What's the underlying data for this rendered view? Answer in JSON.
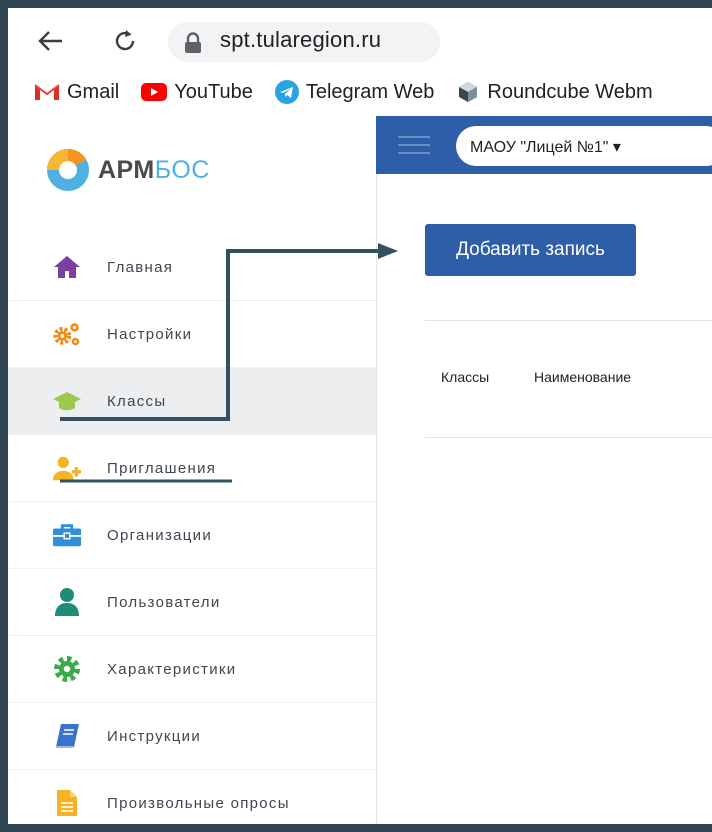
{
  "browser": {
    "url": "spt.tularegion.ru",
    "bookmarks": [
      {
        "label": "Gmail",
        "icon": "gmail-icon"
      },
      {
        "label": "YouTube",
        "icon": "youtube-icon"
      },
      {
        "label": "Telegram Web",
        "icon": "telegram-icon"
      },
      {
        "label": "Roundcube Webm",
        "icon": "roundcube-icon"
      }
    ]
  },
  "logo": {
    "part1": "АРМ",
    "part2": "БОС"
  },
  "sidebar": {
    "items": [
      {
        "label": "Главная",
        "icon": "home-icon",
        "color": "#7b3fa0"
      },
      {
        "label": "Настройки",
        "icon": "gears-icon",
        "color": "#f08c1a"
      },
      {
        "label": "Классы",
        "icon": "graduation-cap-icon",
        "color": "#9cc84b",
        "active": true
      },
      {
        "label": "Приглашения",
        "icon": "user-plus-icon",
        "color": "#f5b324"
      },
      {
        "label": "Организации",
        "icon": "briefcase-icon",
        "color": "#2f8fd8"
      },
      {
        "label": "Пользователи",
        "icon": "user-icon",
        "color": "#1e8c76"
      },
      {
        "label": "Характеристики",
        "icon": "gear-icon",
        "color": "#3aaa4a"
      },
      {
        "label": "Инструкции",
        "icon": "book-icon",
        "color": "#3a74c9"
      },
      {
        "label": "Произвольные опросы",
        "icon": "document-icon",
        "color": "#f5b324"
      }
    ]
  },
  "header": {
    "org_select": "МАОУ \"Лицей №1\""
  },
  "main": {
    "add_button": "Добавить запись",
    "columns": [
      "Классы",
      "Наименование"
    ]
  },
  "colors": {
    "accent": "#2f5ea8",
    "frame": "#2f4452",
    "annotation": "#33505f"
  }
}
